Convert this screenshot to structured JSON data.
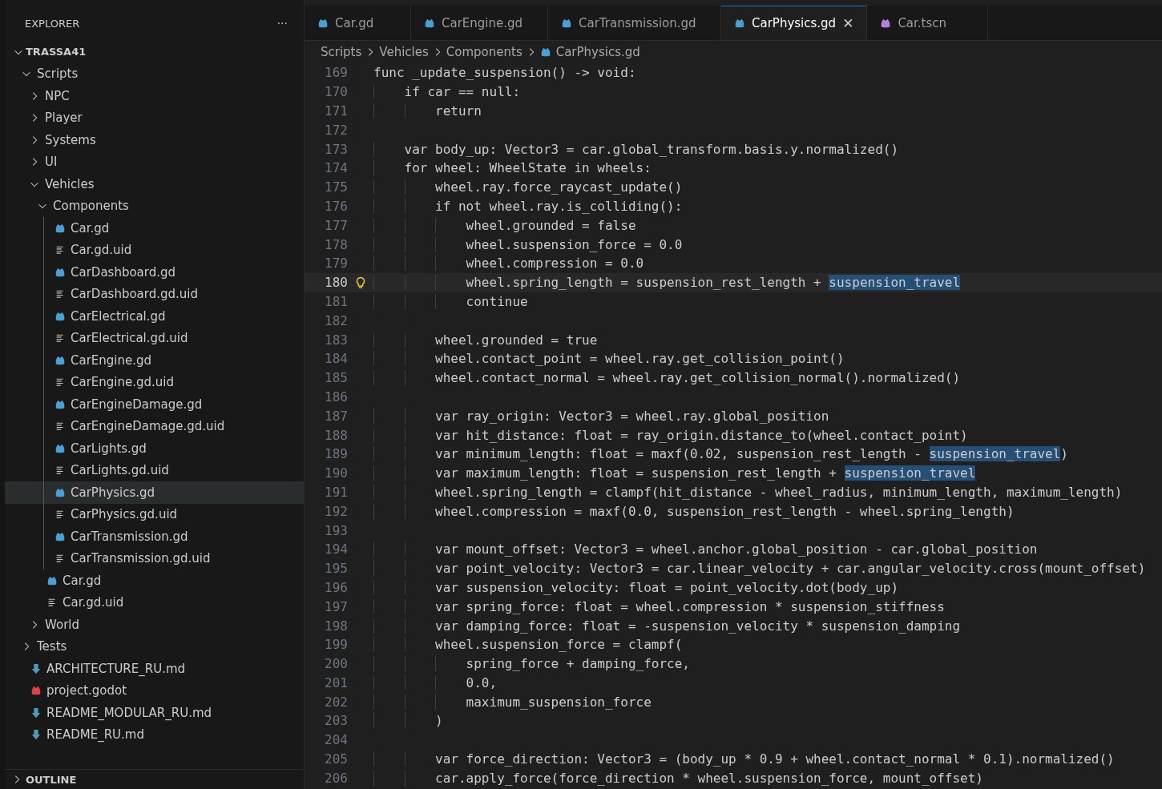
{
  "explorer": {
    "title": "EXPLORER",
    "more": "···"
  },
  "tree": [
    {
      "label": "TRASSA41",
      "kind": "root",
      "expanded": true,
      "selected": false,
      "children": [
        {
          "label": "Scripts",
          "kind": "folder",
          "expanded": true,
          "selected": false,
          "children": [
            {
              "label": "NPC",
              "kind": "folder",
              "expanded": false,
              "selected": false
            },
            {
              "label": "Player",
              "kind": "folder",
              "expanded": false,
              "selected": false
            },
            {
              "label": "Systems",
              "kind": "folder",
              "expanded": false,
              "selected": false
            },
            {
              "label": "UI",
              "kind": "folder",
              "expanded": false,
              "selected": false
            },
            {
              "label": "Vehicles",
              "kind": "folder",
              "expanded": true,
              "selected": false,
              "children": [
                {
                  "label": "Components",
                  "kind": "folder",
                  "expanded": true,
                  "selected": false,
                  "children": [
                    {
                      "label": "Car.gd",
                      "kind": "script",
                      "selected": false
                    },
                    {
                      "label": "Car.gd.uid",
                      "kind": "uid",
                      "selected": false
                    },
                    {
                      "label": "CarDashboard.gd",
                      "kind": "script",
                      "selected": false
                    },
                    {
                      "label": "CarDashboard.gd.uid",
                      "kind": "uid",
                      "selected": false
                    },
                    {
                      "label": "CarElectrical.gd",
                      "kind": "script",
                      "selected": false
                    },
                    {
                      "label": "CarElectrical.gd.uid",
                      "kind": "uid",
                      "selected": false
                    },
                    {
                      "label": "CarEngine.gd",
                      "kind": "script",
                      "selected": false
                    },
                    {
                      "label": "CarEngine.gd.uid",
                      "kind": "uid",
                      "selected": false
                    },
                    {
                      "label": "CarEngineDamage.gd",
                      "kind": "script",
                      "selected": false
                    },
                    {
                      "label": "CarEngineDamage.gd.uid",
                      "kind": "uid",
                      "selected": false
                    },
                    {
                      "label": "CarLights.gd",
                      "kind": "script",
                      "selected": false
                    },
                    {
                      "label": "CarLights.gd.uid",
                      "kind": "uid",
                      "selected": false
                    },
                    {
                      "label": "CarPhysics.gd",
                      "kind": "script",
                      "selected": true
                    },
                    {
                      "label": "CarPhysics.gd.uid",
                      "kind": "uid",
                      "selected": false
                    },
                    {
                      "label": "CarTransmission.gd",
                      "kind": "script",
                      "selected": false
                    },
                    {
                      "label": "CarTransmission.gd.uid",
                      "kind": "uid",
                      "selected": false
                    }
                  ]
                },
                {
                  "label": "Car.gd",
                  "kind": "script",
                  "selected": false
                },
                {
                  "label": "Car.gd.uid",
                  "kind": "uid",
                  "selected": false
                }
              ]
            },
            {
              "label": "World",
              "kind": "folder",
              "expanded": false,
              "selected": false
            }
          ]
        },
        {
          "label": "Tests",
          "kind": "folder",
          "expanded": false,
          "selected": false
        },
        {
          "label": "ARCHITECTURE_RU.md",
          "kind": "markdown",
          "selected": false
        },
        {
          "label": "project.godot",
          "kind": "project",
          "selected": false
        },
        {
          "label": "README_MODULAR_RU.md",
          "kind": "markdown",
          "selected": false
        },
        {
          "label": "README_RU.md",
          "kind": "markdown",
          "selected": false
        }
      ]
    }
  ],
  "outline": {
    "label": "OUTLINE",
    "expanded": false
  },
  "tabs": [
    {
      "label": "Car.gd",
      "kind": "script",
      "selected": false
    },
    {
      "label": "CarEngine.gd",
      "kind": "script",
      "selected": false
    },
    {
      "label": "CarTransmission.gd",
      "kind": "script",
      "selected": false
    },
    {
      "label": "CarPhysics.gd",
      "kind": "script",
      "selected": true,
      "close": "✕"
    },
    {
      "label": "Car.tscn",
      "kind": "scene",
      "selected": false
    }
  ],
  "breadcrumb": [
    {
      "label": "Scripts",
      "kind": "folder"
    },
    {
      "label": "Vehicles",
      "kind": "folder"
    },
    {
      "label": "Components",
      "kind": "folder"
    },
    {
      "label": "CarPhysics.gd",
      "kind": "script"
    }
  ],
  "lines": [
    {
      "number": "169",
      "text": "func _update_suspension() -> void:"
    },
    {
      "number": "170",
      "text": "    if car == null:"
    },
    {
      "number": "171",
      "text": "        return"
    },
    {
      "number": "172"
    },
    {
      "number": "173",
      "text": "    var body_up: Vector3 = car.global_transform.basis.y.normalized()"
    },
    {
      "number": "174",
      "text": "    for wheel: WheelState in wheels:"
    },
    {
      "number": "175",
      "text": "        wheel.ray.force_raycast_update()"
    },
    {
      "number": "176",
      "text": "        if not wheel.ray.is_colliding():"
    },
    {
      "number": "177",
      "text": "            wheel.grounded = false"
    },
    {
      "number": "178",
      "text": "            wheel.suspension_force = 0.0"
    },
    {
      "number": "179",
      "text": "            wheel.compression = 0.0"
    },
    {
      "number": "180",
      "current": true,
      "lightbulb": true,
      "segments": [
        {
          "text": "            wheel.spring_length = suspension_rest_length + ",
          "highlighted": false
        },
        {
          "text": "suspension_travel",
          "highlighted": true
        }
      ]
    },
    {
      "number": "181",
      "text": "            continue"
    },
    {
      "number": "182"
    },
    {
      "number": "183",
      "text": "        wheel.grounded = true"
    },
    {
      "number": "184",
      "text": "        wheel.contact_point = wheel.ray.get_collision_point()"
    },
    {
      "number": "185",
      "text": "        wheel.contact_normal = wheel.ray.get_collision_normal().normalized()"
    },
    {
      "number": "186"
    },
    {
      "number": "187",
      "text": "        var ray_origin: Vector3 = wheel.ray.global_position"
    },
    {
      "number": "188",
      "text": "        var hit_distance: float = ray_origin.distance_to(wheel.contact_point)"
    },
    {
      "number": "189",
      "segments": [
        {
          "text": "        var minimum_length: float = maxf(0.02, suspension_rest_length - ",
          "highlighted": false
        },
        {
          "text": "suspension_travel",
          "highlighted": true
        },
        {
          "text": ")",
          "highlighted": false
        }
      ]
    },
    {
      "number": "190",
      "segments": [
        {
          "text": "        var maximum_length: float = suspension_rest_length + ",
          "highlighted": false
        },
        {
          "text": "suspension_travel",
          "highlighted": true
        }
      ]
    },
    {
      "number": "191",
      "text": "        wheel.spring_length = clampf(hit_distance - wheel_radius, minimum_length, maximum_length)"
    },
    {
      "number": "192",
      "text": "        wheel.compression = maxf(0.0, suspension_rest_length - wheel.spring_length)"
    },
    {
      "number": "193"
    },
    {
      "number": "194",
      "text": "        var mount_offset: Vector3 = wheel.anchor.global_position - car.global_position"
    },
    {
      "number": "195",
      "text": "        var point_velocity: Vector3 = car.linear_velocity + car.angular_velocity.cross(mount_offset)"
    },
    {
      "number": "196",
      "text": "        var suspension_velocity: float = point_velocity.dot(body_up)"
    },
    {
      "number": "197",
      "text": "        var spring_force: float = wheel.compression * suspension_stiffness"
    },
    {
      "number": "198",
      "text": "        var damping_force: float = -suspension_velocity * suspension_damping"
    },
    {
      "number": "199",
      "text": "        wheel.suspension_force = clampf("
    },
    {
      "number": "200",
      "text": "            spring_force + damping_force,"
    },
    {
      "number": "201",
      "text": "            0.0,"
    },
    {
      "number": "202",
      "text": "            maximum_suspension_force"
    },
    {
      "number": "203",
      "text": "        )"
    },
    {
      "number": "204"
    },
    {
      "number": "205",
      "text": "        var force_direction: Vector3 = (body_up * 0.9 + wheel.contact_normal * 0.1).normalized()"
    },
    {
      "number": "206",
      "text": "        car.apply_force(force_direction * wheel.suspension_force, mount_offset)"
    }
  ]
}
